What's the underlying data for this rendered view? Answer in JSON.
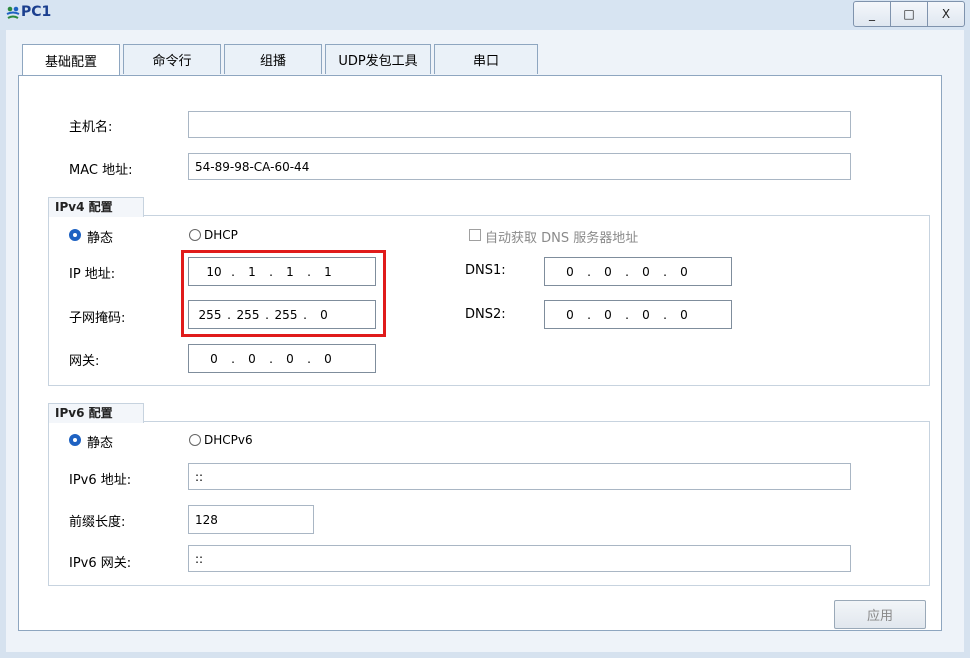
{
  "window": {
    "title": "PC1",
    "buttons": {
      "minimize": "_",
      "maximize": "□",
      "close": "X"
    }
  },
  "tabs": [
    {
      "label": "基础配置",
      "active": true
    },
    {
      "label": "命令行",
      "active": false
    },
    {
      "label": "组播",
      "active": false
    },
    {
      "label": "UDP发包工具",
      "active": false
    },
    {
      "label": "串口",
      "active": false
    }
  ],
  "basic": {
    "hostname_label": "主机名:",
    "hostname_value": "",
    "mac_label": "MAC 地址:",
    "mac_value": "54-89-98-CA-60-44"
  },
  "ipv4": {
    "group_title": "IPv4 配置",
    "static_label": "静态",
    "dhcp_label": "DHCP",
    "auto_dns_label": "自动获取 DNS 服务器地址",
    "ip_label": "IP 地址:",
    "ip": [
      "10",
      "1",
      "1",
      "1"
    ],
    "mask_label": "子网掩码:",
    "mask": [
      "255",
      "255",
      "255",
      "0"
    ],
    "gateway_label": "网关:",
    "gateway": [
      "0",
      "0",
      "0",
      "0"
    ],
    "dns1_label": "DNS1:",
    "dns1": [
      "0",
      "0",
      "0",
      "0"
    ],
    "dns2_label": "DNS2:",
    "dns2": [
      "0",
      "0",
      "0",
      "0"
    ],
    "mode": "static"
  },
  "ipv6": {
    "group_title": "IPv6 配置",
    "static_label": "静态",
    "dhcp_label": "DHCPv6",
    "ip_label": "IPv6 地址:",
    "ip_value": "::",
    "prefix_label": "前缀长度:",
    "prefix_value": "128",
    "gateway_label": "IPv6 网关:",
    "gateway_value": "::",
    "mode": "static"
  },
  "apply_label": "应用",
  "colors": {
    "accent": "#1e62c2",
    "highlight": "#e01b1b",
    "title_text": "#1b3f8f"
  }
}
